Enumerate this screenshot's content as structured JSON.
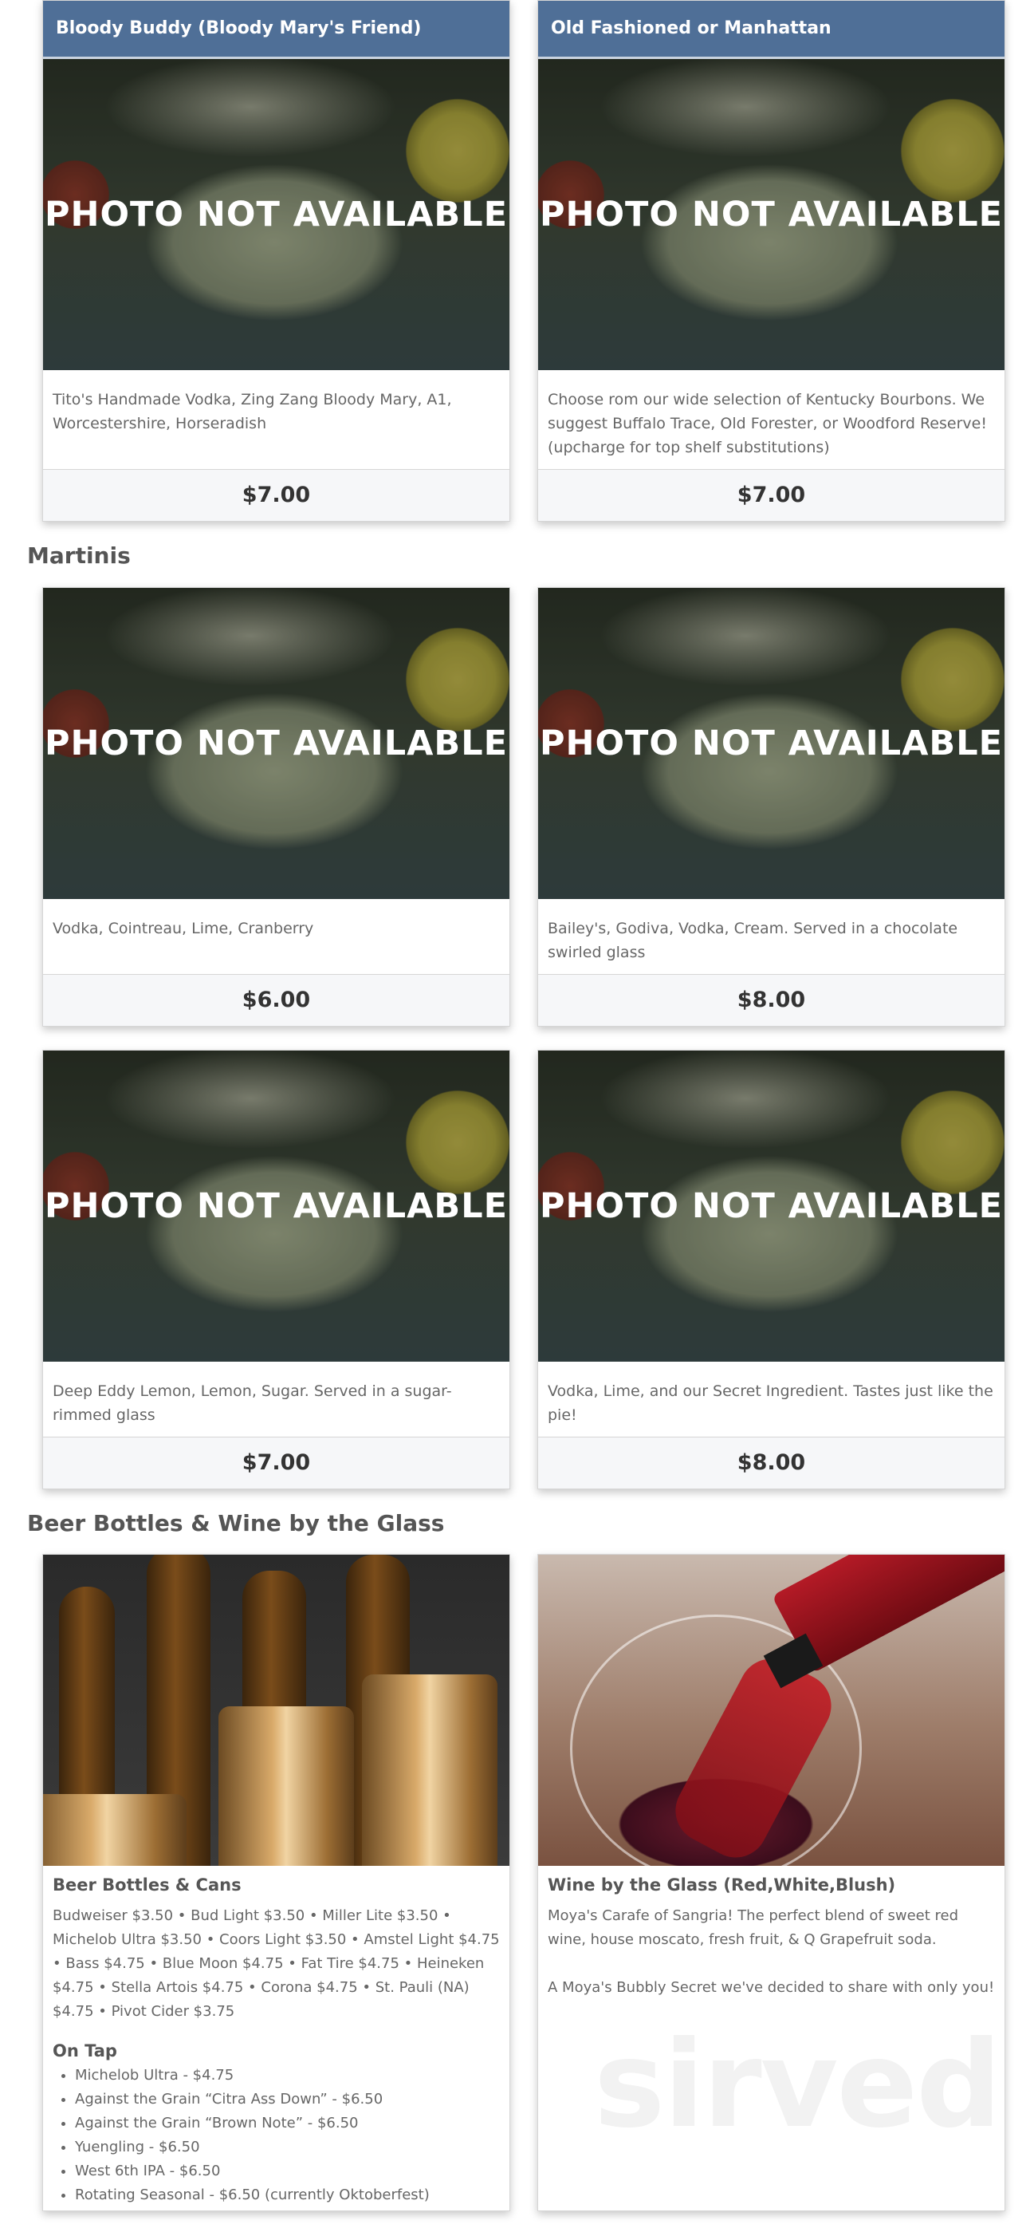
{
  "photo_placeholder": "PHOTO NOT AVAILABLE",
  "cards_top": [
    {
      "title": "Bloody Buddy (Bloody Mary's Friend)",
      "description": "Tito's Handmade Vodka, Zing Zang Bloody Mary, A1, Worcestershire, Horseradish",
      "price": "$7.00"
    },
    {
      "title": "Old Fashioned or Manhattan",
      "description": "Choose rom our wide selection of Kentucky Bourbons. We suggest Buffalo Trace, Old Forester, or Woodford Reserve! (upcharge for top shelf substitutions)",
      "price": "$7.00"
    }
  ],
  "sections": {
    "martinis": "Martinis",
    "beer_wine": "Beer Bottles & Wine by the Glass"
  },
  "martinis": [
    {
      "description": "Vodka, Cointreau, Lime, Cranberry",
      "price": "$6.00"
    },
    {
      "description": "Bailey's, Godiva, Vodka, Cream. Served in a chocolate swirled glass",
      "price": "$8.00"
    },
    {
      "description": "Deep Eddy Lemon, Lemon, Sugar. Served in a sugar-rimmed glass",
      "price": "$7.00"
    },
    {
      "description": "Vodka, Lime, and our Secret Ingredient. Tastes just like the pie!",
      "price": "$8.00"
    }
  ],
  "beer": {
    "title": "Beer Bottles & Cans",
    "text": "Budweiser $3.50 • Bud Light $3.50 • Miller Lite $3.50 • Michelob Ultra $3.50 • Coors Light $3.50 • Amstel Light $4.75 • Bass $4.75 • Blue Moon $4.75 • Fat Tire $4.75 • Heineken $4.75 • Stella Artois $4.75 • Corona $4.75 • St. Pauli (NA) $4.75 • Pivot Cider $3.75",
    "on_tap_title": "On Tap",
    "on_tap": [
      "Michelob Ultra - $4.75",
      "Against the Grain “Citra Ass Down” - $6.50",
      "Against the Grain “Brown Note” - $6.50",
      "Yuengling - $6.50",
      "West 6th IPA - $6.50",
      "Rotating Seasonal - $6.50 (currently Oktoberfest)"
    ]
  },
  "wine": {
    "title": "Wine by the Glass (Red,White,Blush)",
    "text1": "Moya's Carafe of Sangria! The perfect blend of sweet red wine, house moscato, fresh fruit, & Q Grapefruit soda.",
    "text2": "A Moya's Bubbly Secret we've decided to share with only you!"
  },
  "watermark": "sirved",
  "colors": {
    "header": "#4f6f97",
    "price_bg": "#f6f7f9"
  }
}
